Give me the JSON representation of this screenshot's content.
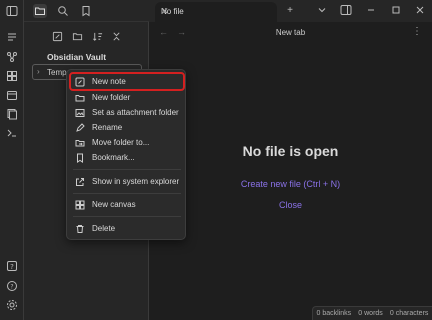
{
  "sidebar": {
    "vault_name": "Obsidian Vault",
    "folder_label": "Temp"
  },
  "tab": {
    "label": "No file",
    "close_glyph": "✕",
    "new_tab_glyph": "+"
  },
  "nav": {
    "title": "New tab",
    "back_glyph": "←",
    "forward_glyph": "→",
    "more_glyph": "⋮"
  },
  "context_menu": {
    "items": [
      {
        "label": "New note",
        "icon": "edit-icon"
      },
      {
        "label": "New folder",
        "icon": "folder-icon"
      },
      {
        "label": "Set as attachment folder",
        "icon": "image-icon"
      },
      {
        "label": "Rename",
        "icon": "pencil-icon"
      },
      {
        "label": "Move folder to...",
        "icon": "move-icon"
      },
      {
        "label": "Bookmark...",
        "icon": "bookmark-icon"
      },
      {
        "label": "Show in system explorer",
        "icon": "external-icon"
      },
      {
        "label": "New canvas",
        "icon": "canvas-icon"
      },
      {
        "label": "Delete",
        "icon": "trash-icon"
      }
    ]
  },
  "main": {
    "empty_title": "No file is open",
    "create_link": "Create new file (Ctrl + N)",
    "close_link": "Close"
  },
  "status": {
    "backlinks": "0 backlinks",
    "words": "0 words",
    "characters": "0 characters"
  },
  "colors": {
    "accent": "#8a72e8",
    "highlight_border": "#d42020"
  }
}
